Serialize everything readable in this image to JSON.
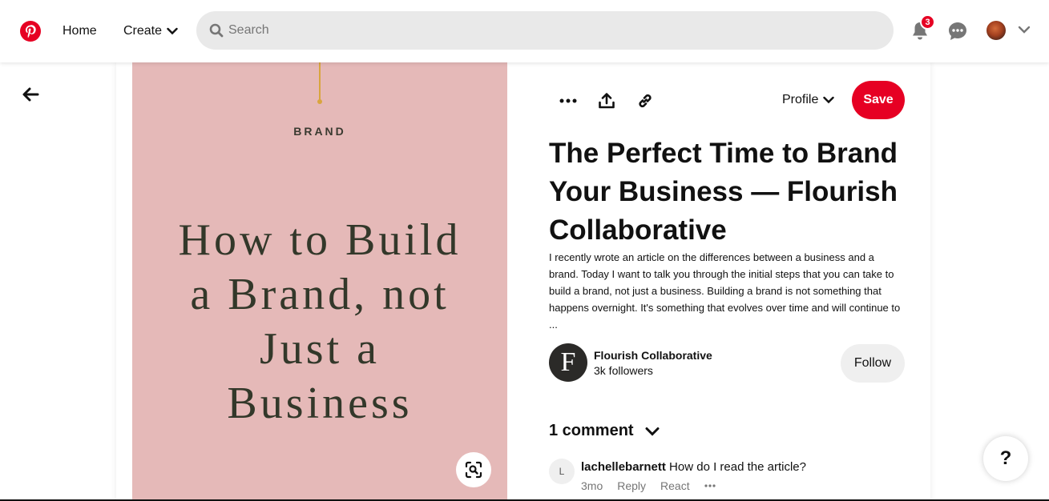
{
  "header": {
    "nav_home": "Home",
    "nav_create": "Create",
    "search_placeholder": "Search",
    "notification_count": "3",
    "brand_color": "#e60023"
  },
  "pin": {
    "image_label": "BRAND",
    "image_text_lines": [
      "How to Build",
      "a Brand, not",
      "Just a",
      "Business"
    ],
    "image_bg": "#e5b9b8"
  },
  "actions": {
    "profile_label": "Profile",
    "save_label": "Save"
  },
  "title": "The Perfect Time to Brand Your Business — Flourish Collaborative",
  "description": "I recently wrote an article on the differences between a business and a brand. Today I want to talk you through the initial steps that you can take to build a brand, not just a business. Building a brand is not something that happens overnight. It's something that evolves over time and will continue to ...",
  "creator": {
    "avatar_letter": "F",
    "name": "Flourish Collaborative",
    "followers": "3k followers",
    "follow_label": "Follow"
  },
  "comments": {
    "heading": "1 comment",
    "items": [
      {
        "avatar_letter": "L",
        "user": "lachellebarnett",
        "text": "How do I read the article?",
        "age": "3mo",
        "reply_label": "Reply",
        "react_label": "React"
      }
    ]
  },
  "help_label": "?"
}
